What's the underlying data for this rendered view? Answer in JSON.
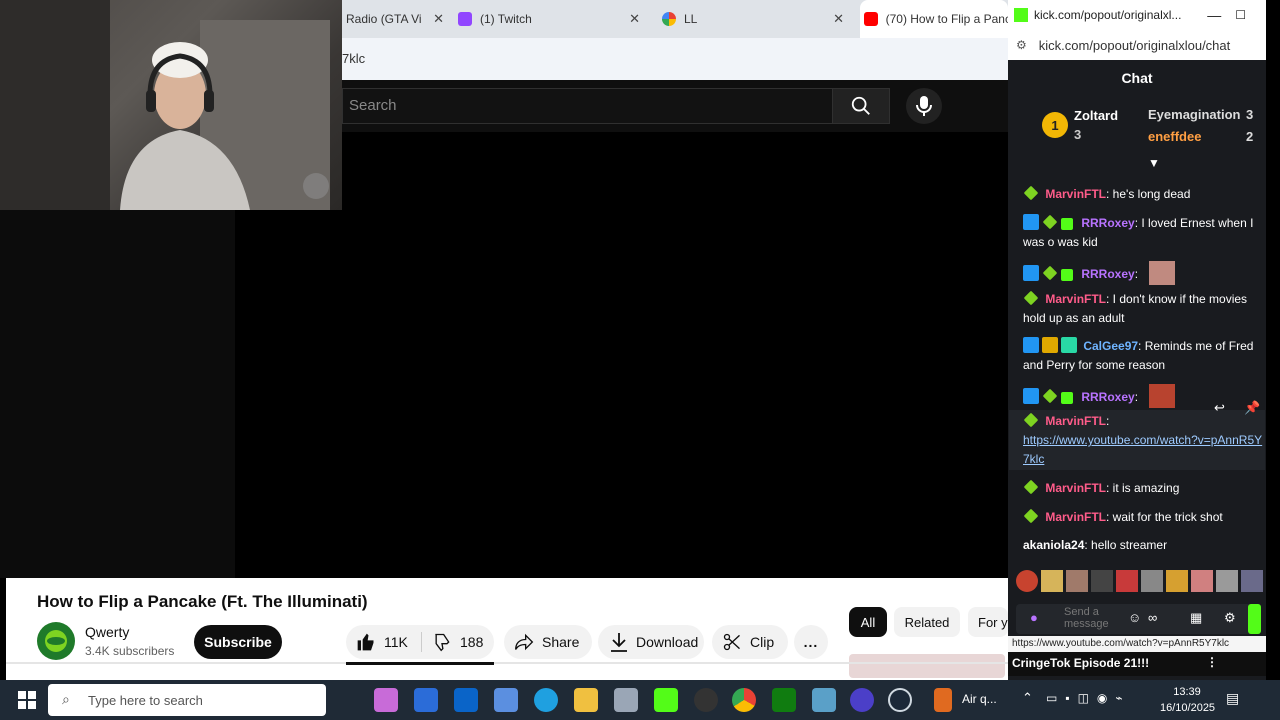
{
  "browser": {
    "tabs": [
      {
        "label": "Radio (GTA Vi",
        "color": "#2b6cd8"
      },
      {
        "label": "(1) Twitch",
        "color": "#9146ff"
      },
      {
        "label": "LL",
        "color": "#e94235"
      },
      {
        "label": "(70) How to Flip a Panca",
        "color": "#ff0000"
      }
    ],
    "address_fragment": "7klc"
  },
  "youtube": {
    "search_placeholder": "Search",
    "video_title": "How to Flip a Pancake (Ft. The Illuminati)",
    "channel_name": "Qwerty",
    "channel_subs": "3.4K subscribers",
    "subscribe_label": "Subscribe",
    "likes": "11K",
    "dislikes": "188",
    "share_label": "Share",
    "download_label": "Download",
    "clip_label": "Clip",
    "more_label": "...",
    "chips": [
      "All",
      "Related",
      "For y"
    ],
    "next_video_title": "CringeTok Episode 21!!!"
  },
  "chat": {
    "window_title": "kick.com/popout/originalxl...",
    "url": "kick.com/popout/originalxlou/chat",
    "header": "Chat",
    "leaderboard": [
      {
        "rank": "1",
        "name": "Zoltard",
        "count": "3"
      },
      {
        "name": "Eyemagination",
        "count": "3"
      },
      {
        "name": "eneffdee",
        "count": "2"
      }
    ],
    "messages": [
      {
        "user": "MarvinFTL",
        "color": "#ff5c8a",
        "text": ": he's long dead"
      },
      {
        "user": "RRRoxey",
        "color": "#b873ff",
        "text": ": I loved Ernest when I was o was kid"
      },
      {
        "user": "RRRoxey",
        "color": "#b873ff",
        "text": ":"
      },
      {
        "user": "MarvinFTL",
        "color": "#ff5c8a",
        "text": ": I don't know if the movies hold up as an adult"
      },
      {
        "user": "CalGee97",
        "color": "#6fb4ff",
        "text": ": Reminds me of Fred and Perry for some reason"
      },
      {
        "user": "RRRoxey",
        "color": "#b873ff",
        "text": ":"
      },
      {
        "user": "MarvinFTL",
        "color": "#ff5c8a",
        "text": ":",
        "link": "https://www.youtube.com/watch?v=pAnnR5Y7klc"
      },
      {
        "user": "MarvinFTL",
        "color": "#ff5c8a",
        "text": ": it is amazing"
      },
      {
        "user": "MarvinFTL",
        "color": "#ff5c8a",
        "text": ": wait for the trick shot"
      },
      {
        "user": "akaniola24",
        "color": "#ffffff",
        "text": ": hello streamer"
      }
    ],
    "input_placeholder": "Send a message",
    "link_tooltip": "https://www.youtube.com/watch?v=pAnnR5Y7klc"
  },
  "taskbar": {
    "search_placeholder": "Type here to search",
    "air_quality": "Air q...",
    "time": "13:39",
    "date": "16/10/2025"
  }
}
